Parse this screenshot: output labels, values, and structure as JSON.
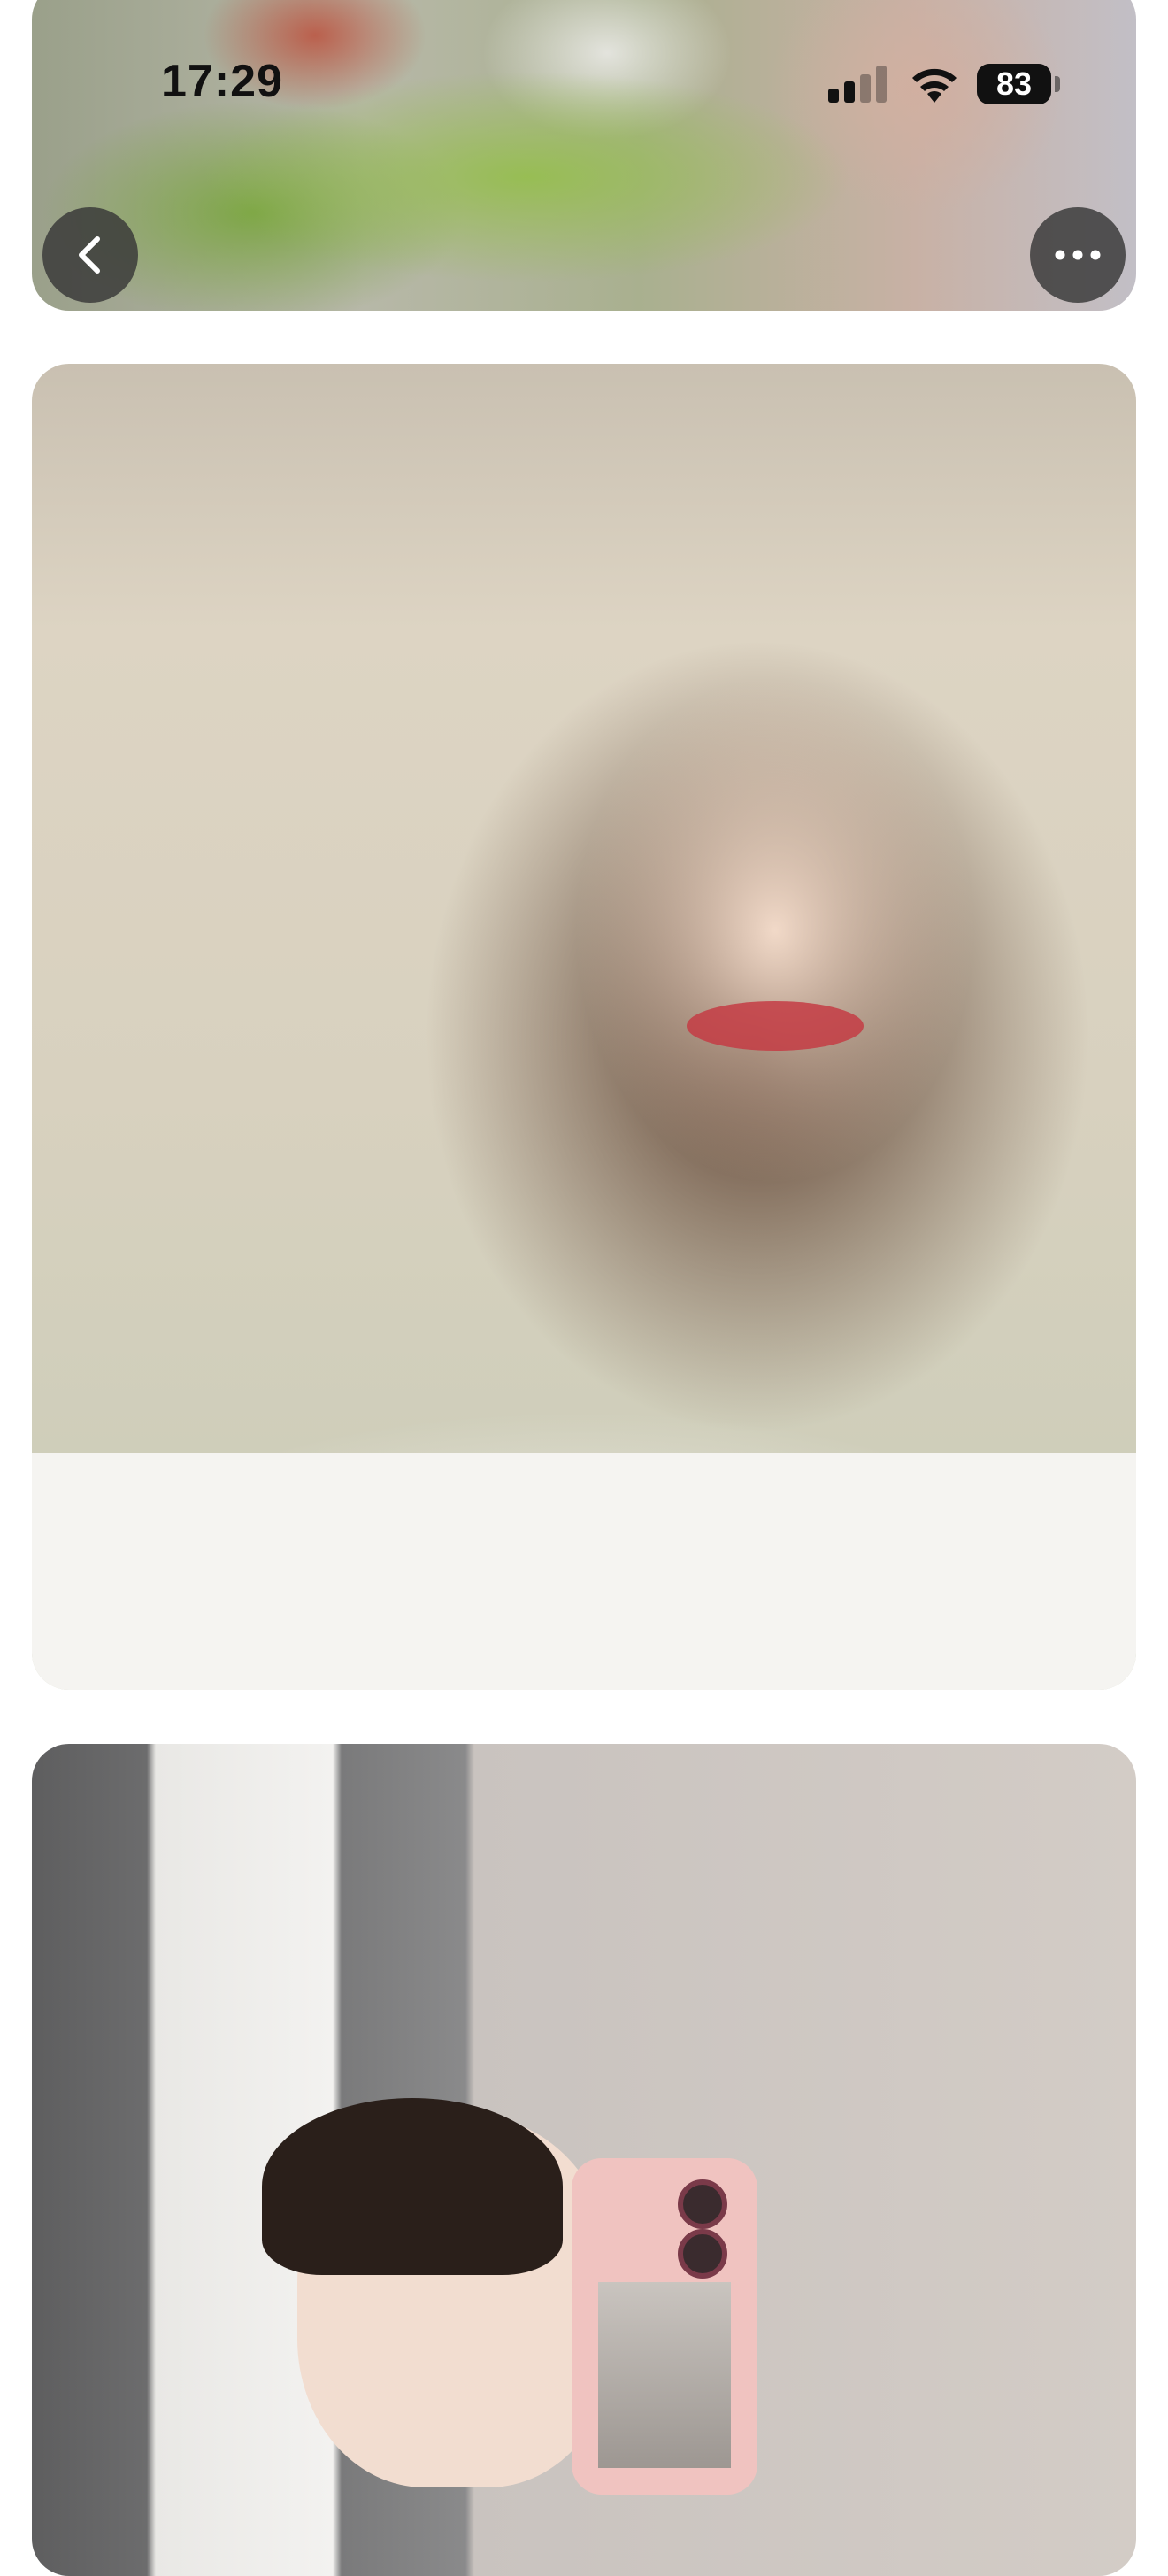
{
  "status_bar": {
    "time": "17:29",
    "battery": "83",
    "icons": [
      "signal-icon",
      "wifi-icon",
      "battery-icon"
    ]
  },
  "nav": {
    "back_icon": "chevron-left-icon",
    "more_icon": "more-horizontal-icon"
  },
  "gallery": {
    "photos": [
      "garden-photo",
      "indoor-selfie-photo",
      "mirror-selfie-photo"
    ]
  },
  "colors": {
    "button_bg": "#373737",
    "background": "#ffffff"
  }
}
